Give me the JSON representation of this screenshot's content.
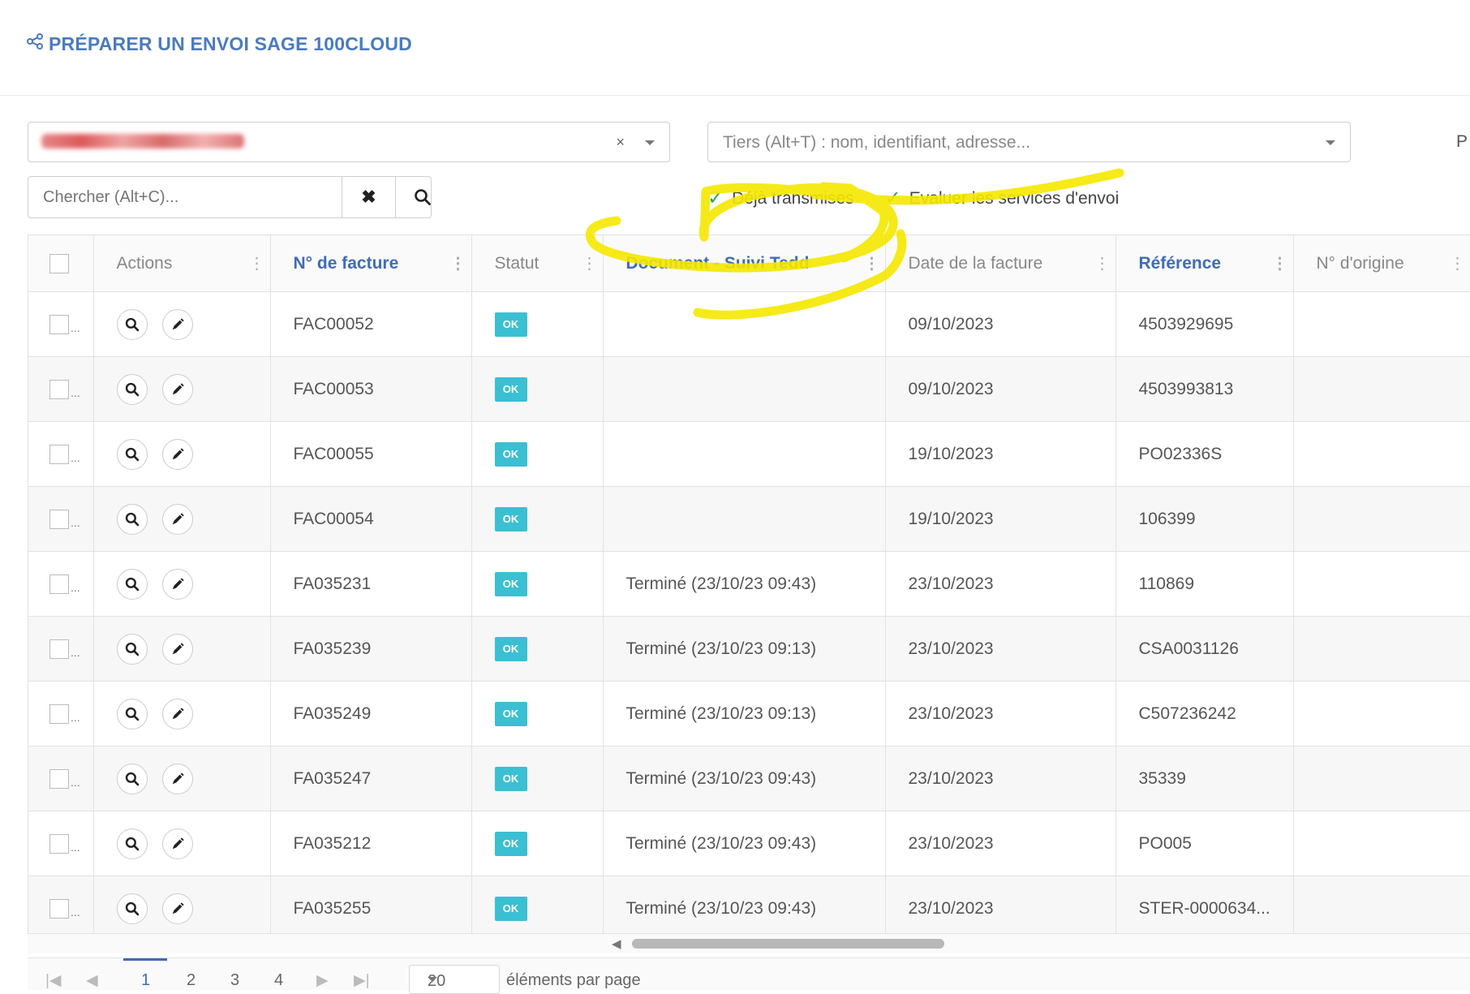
{
  "header": {
    "title": "PRÉPARER UN ENVOI SAGE 100CLOUD"
  },
  "filters": {
    "company_clear": "×",
    "tiers_placeholder": "Tiers (Alt+T) : nom, identifiant, adresse...",
    "cut_label": "P",
    "search_placeholder": "Chercher (Alt+C)...",
    "clear_symbol": "✖"
  },
  "toggles": [
    {
      "label": "Déjà transmises",
      "checked": true
    },
    {
      "label": "Evaluer les services d'envoi",
      "checked": true
    }
  ],
  "table": {
    "columns": {
      "actions": "Actions",
      "invoice_no": "N° de facture",
      "status": "Statut",
      "tracking": "Document - Suivi Tedd",
      "date": "Date de la facture",
      "reference": "Référence",
      "origin": "N° d'origine"
    },
    "rows": [
      {
        "invoice_no": "FAC00052",
        "status": "OK",
        "tracking": "",
        "date": "09/10/2023",
        "reference": "4503929695",
        "origin": ""
      },
      {
        "invoice_no": "FAC00053",
        "status": "OK",
        "tracking": "",
        "date": "09/10/2023",
        "reference": "4503993813",
        "origin": ""
      },
      {
        "invoice_no": "FAC00055",
        "status": "OK",
        "tracking": "",
        "date": "19/10/2023",
        "reference": "PO02336S",
        "origin": ""
      },
      {
        "invoice_no": "FAC00054",
        "status": "OK",
        "tracking": "",
        "date": "19/10/2023",
        "reference": "106399",
        "origin": ""
      },
      {
        "invoice_no": "FA035231",
        "status": "OK",
        "tracking": "Terminé (23/10/23 09:43)",
        "date": "23/10/2023",
        "reference": "110869",
        "origin": ""
      },
      {
        "invoice_no": "FA035239",
        "status": "OK",
        "tracking": "Terminé (23/10/23 09:13)",
        "date": "23/10/2023",
        "reference": "CSA0031126",
        "origin": ""
      },
      {
        "invoice_no": "FA035249",
        "status": "OK",
        "tracking": "Terminé (23/10/23 09:13)",
        "date": "23/10/2023",
        "reference": "C507236242",
        "origin": ""
      },
      {
        "invoice_no": "FA035247",
        "status": "OK",
        "tracking": "Terminé (23/10/23 09:43)",
        "date": "23/10/2023",
        "reference": "35339",
        "origin": ""
      },
      {
        "invoice_no": "FA035212",
        "status": "OK",
        "tracking": "Terminé (23/10/23 09:43)",
        "date": "23/10/2023",
        "reference": "PO005",
        "origin": ""
      },
      {
        "invoice_no": "FA035255",
        "status": "OK",
        "tracking": "Terminé (23/10/23 09:43)",
        "date": "23/10/2023",
        "reference": "STER-0000634...",
        "origin": ""
      }
    ]
  },
  "pager": {
    "pages": [
      "1",
      "2",
      "3",
      "4"
    ],
    "current_page": "1",
    "page_size": "20",
    "per_page_label": "éléments par page"
  },
  "colors": {
    "accent": "#3f6cb5",
    "badge": "#3bbfd2",
    "highlight": "#f5e800",
    "check": "#2fa84f"
  },
  "icons": [
    "share-icon",
    "search-icon",
    "pencil-icon",
    "check-icon",
    "chevron-down-icon"
  ]
}
